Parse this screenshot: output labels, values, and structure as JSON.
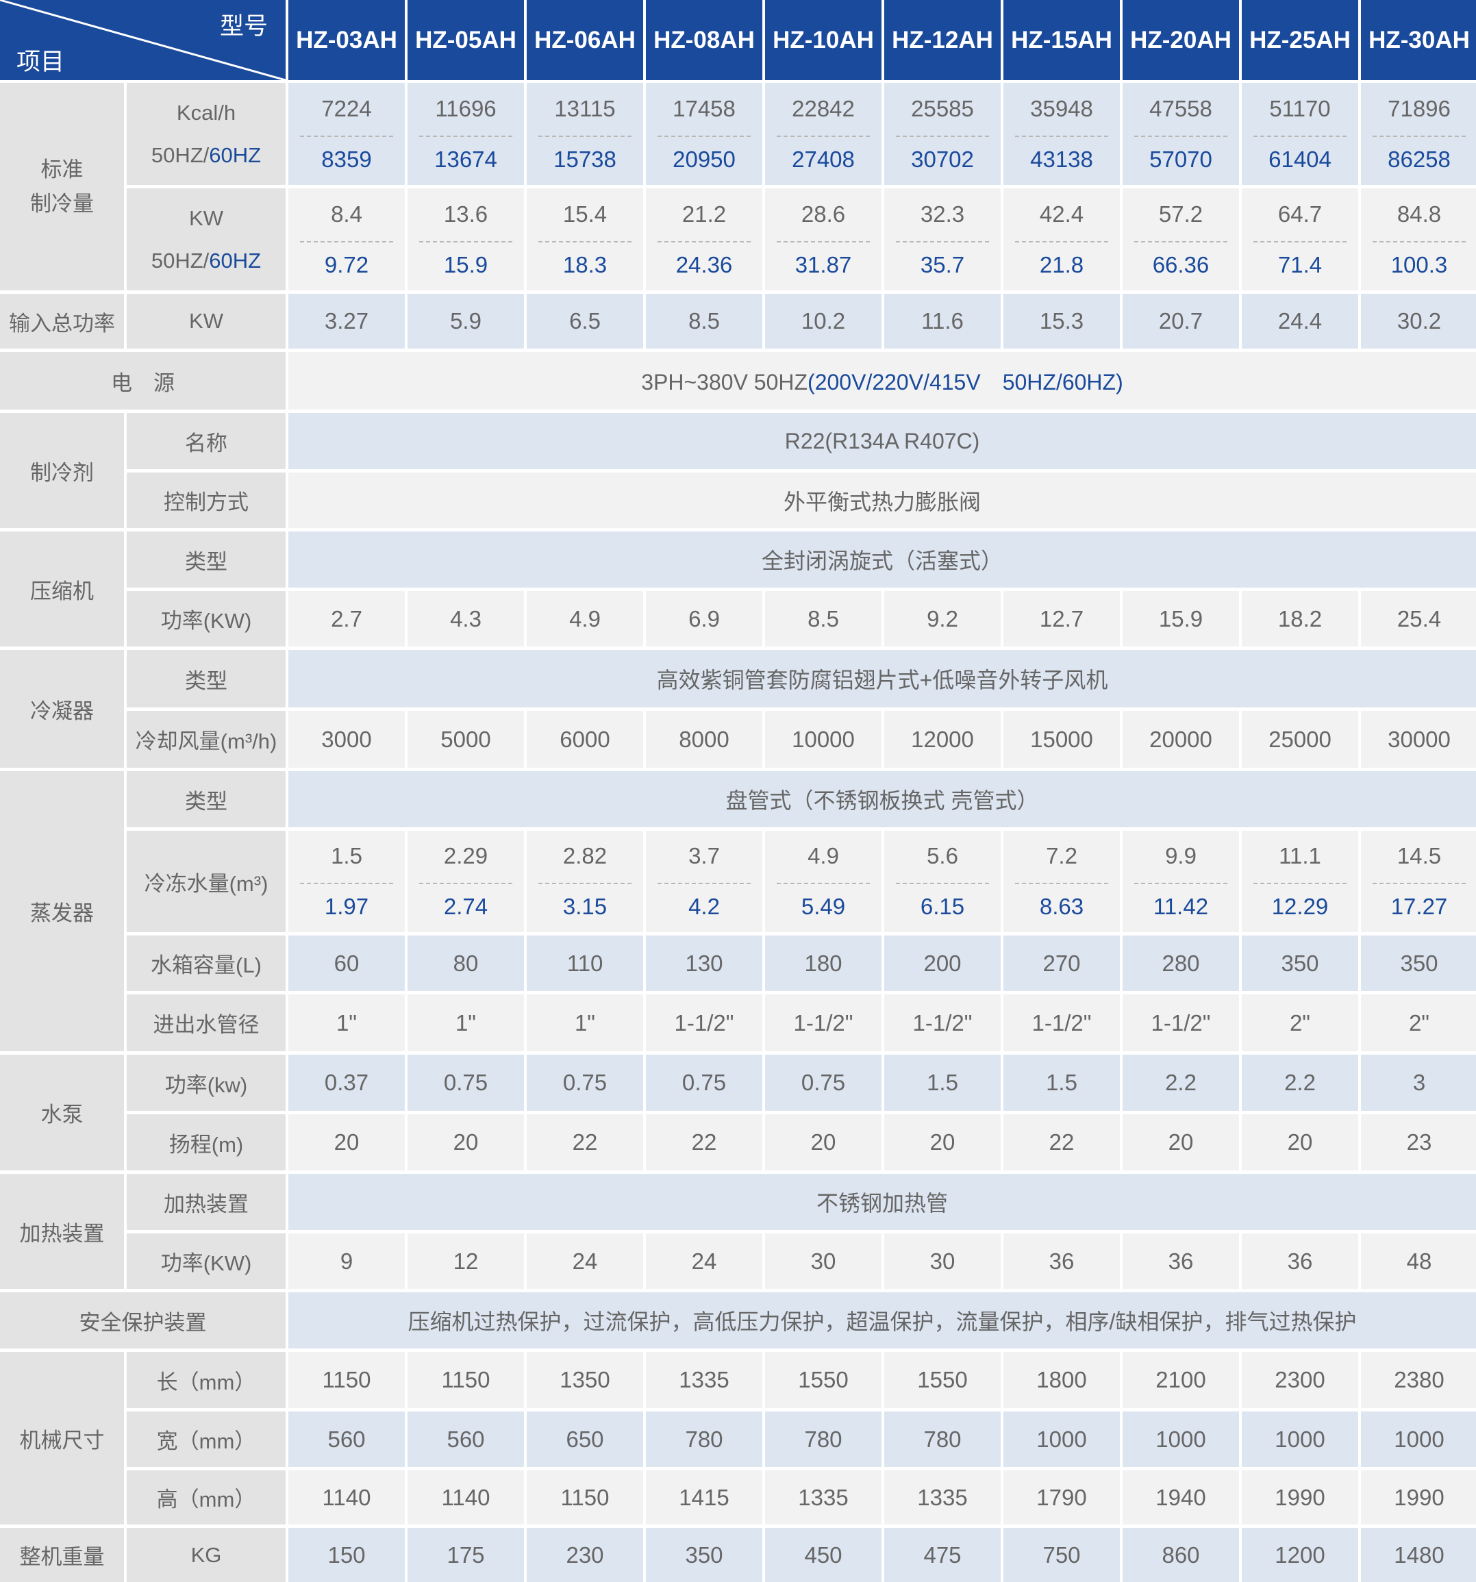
{
  "header": {
    "corner_model": "型号",
    "corner_item": "项目",
    "models": [
      "HZ-03AH",
      "HZ-05AH",
      "HZ-06AH",
      "HZ-08AH",
      "HZ-10AH",
      "HZ-12AH",
      "HZ-15AH",
      "HZ-20AH",
      "HZ-25AH",
      "HZ-30AH"
    ]
  },
  "cooling": {
    "label_l1": "标准",
    "label_l2": "制冷量",
    "kcal_unit": "Kcal/h",
    "kw_unit": "KW",
    "freq_prefix": "50HZ/",
    "freq_suffix": "60HZ",
    "kcal_50": [
      "7224",
      "11696",
      "13115",
      "17458",
      "22842",
      "25585",
      "35948",
      "47558",
      "51170",
      "71896"
    ],
    "kcal_60": [
      "8359",
      "13674",
      "15738",
      "20950",
      "27408",
      "30702",
      "43138",
      "57070",
      "61404",
      "86258"
    ],
    "kw_50": [
      "8.4",
      "13.6",
      "15.4",
      "21.2",
      "28.6",
      "32.3",
      "42.4",
      "57.2",
      "64.7",
      "84.8"
    ],
    "kw_60": [
      "9.72",
      "15.9",
      "18.3",
      "24.36",
      "31.87",
      "35.7",
      "21.8",
      "66.36",
      "71.4",
      "100.3"
    ]
  },
  "input_power": {
    "label": "输入总功率",
    "unit": "KW",
    "values": [
      "3.27",
      "5.9",
      "6.5",
      "8.5",
      "10.2",
      "11.6",
      "15.3",
      "20.7",
      "24.4",
      "30.2"
    ]
  },
  "power_supply": {
    "label": "电　源",
    "value_plain": "3PH~380V 50HZ",
    "value_blue": "(200V/220V/415V　50HZ/60HZ)"
  },
  "refrigerant": {
    "label": "制冷剂",
    "name_label": "名称",
    "name_value": "R22(R134A R407C)",
    "control_label": "控制方式",
    "control_value": "外平衡式热力膨胀阀"
  },
  "compressor": {
    "label": "压缩机",
    "type_label": "类型",
    "type_value": "全封闭涡旋式（活塞式）",
    "power_label": "功率(KW)",
    "power_values": [
      "2.7",
      "4.3",
      "4.9",
      "6.9",
      "8.5",
      "9.2",
      "12.7",
      "15.9",
      "18.2",
      "25.4"
    ]
  },
  "condenser": {
    "label": "冷凝器",
    "type_label": "类型",
    "type_value": "高效紫铜管套防腐铝翅片式+低噪音外转子风机",
    "air_label": "冷却风量(m³/h)",
    "air_values": [
      "3000",
      "5000",
      "6000",
      "8000",
      "10000",
      "12000",
      "15000",
      "20000",
      "25000",
      "30000"
    ]
  },
  "evaporator": {
    "label": "蒸发器",
    "type_label": "类型",
    "type_value": "盘管式（不锈钢板换式 壳管式）",
    "water_label": "冷冻水量(m³)",
    "water_50": [
      "1.5",
      "2.29",
      "2.82",
      "3.7",
      "4.9",
      "5.6",
      "7.2",
      "9.9",
      "11.1",
      "14.5"
    ],
    "water_60": [
      "1.97",
      "2.74",
      "3.15",
      "4.2",
      "5.49",
      "6.15",
      "8.63",
      "11.42",
      "12.29",
      "17.27"
    ],
    "tank_label": "水箱容量(L)",
    "tank_values": [
      "60",
      "80",
      "110",
      "130",
      "180",
      "200",
      "270",
      "280",
      "350",
      "350"
    ],
    "pipe_label": "进出水管径",
    "pipe_values": [
      "1\"",
      "1\"",
      "1\"",
      "1-1/2\"",
      "1-1/2\"",
      "1-1/2\"",
      "1-1/2\"",
      "1-1/2\"",
      "2\"",
      "2\""
    ]
  },
  "pump": {
    "label": "水泵",
    "power_label": "功率(kw)",
    "power_values": [
      "0.37",
      "0.75",
      "0.75",
      "0.75",
      "0.75",
      "1.5",
      "1.5",
      "2.2",
      "2.2",
      "3"
    ],
    "head_label": "扬程(m)",
    "head_values": [
      "20",
      "20",
      "22",
      "22",
      "20",
      "20",
      "22",
      "20",
      "20",
      "23"
    ]
  },
  "heater": {
    "label": "加热装置",
    "device_label": "加热装置",
    "device_value": "不锈钢加热管",
    "power_label": "功率(KW)",
    "power_values": [
      "9",
      "12",
      "24",
      "24",
      "30",
      "30",
      "36",
      "36",
      "36",
      "48"
    ]
  },
  "safety": {
    "label": "安全保护装置",
    "value": "压缩机过热保护，过流保护，高低压力保护，超温保护，流量保护，相序/缺相保护，排气过热保护"
  },
  "dimensions": {
    "label": "机械尺寸",
    "length_label": "长（mm）",
    "length_values": [
      "1150",
      "1150",
      "1350",
      "1335",
      "1550",
      "1550",
      "1800",
      "2100",
      "2300",
      "2380"
    ],
    "width_label": "宽（mm）",
    "width_values": [
      "560",
      "560",
      "650",
      "780",
      "780",
      "780",
      "1000",
      "1000",
      "1000",
      "1000"
    ],
    "height_label": "高（mm）",
    "height_values": [
      "1140",
      "1140",
      "1150",
      "1415",
      "1335",
      "1335",
      "1790",
      "1940",
      "1990",
      "1990"
    ]
  },
  "weight": {
    "label": "整机重量",
    "unit": "KG",
    "values": [
      "150",
      "175",
      "230",
      "350",
      "450",
      "475",
      "750",
      "860",
      "1200",
      "1480"
    ]
  },
  "colors": {
    "header_blue": "#1a4a9b",
    "label_gray": "#e3e3e3",
    "row_blue": "#dde5f1",
    "row_gray": "#f2f2f2",
    "text_gray": "#666666"
  }
}
